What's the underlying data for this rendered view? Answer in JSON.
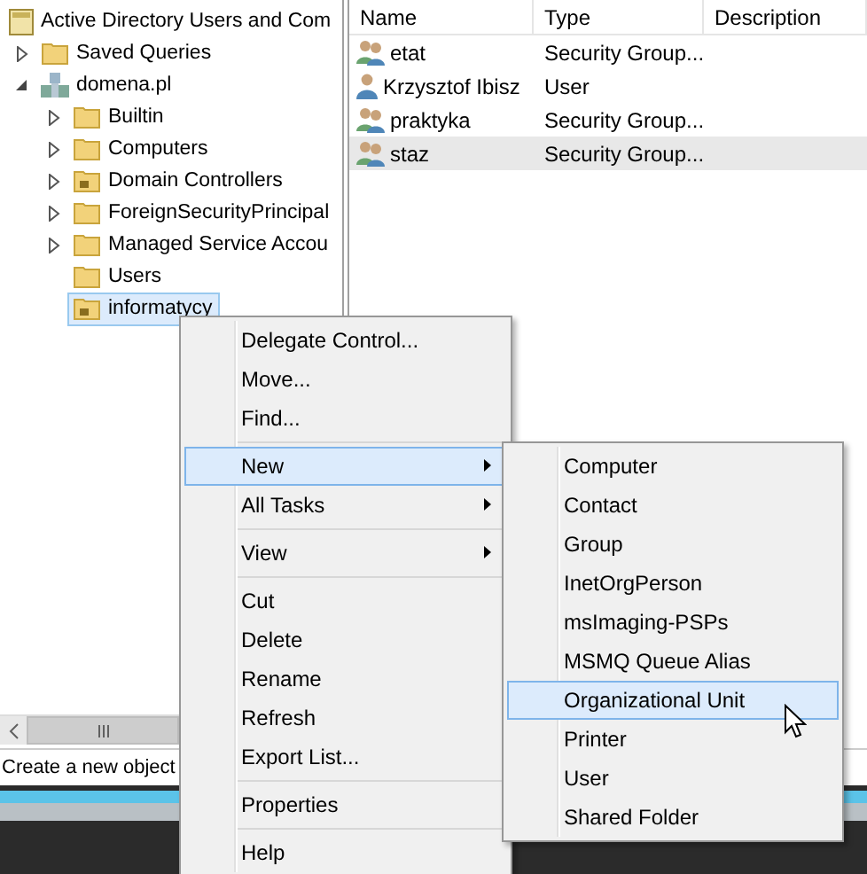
{
  "tree": {
    "title": "Active Directory Users and Com",
    "items": [
      {
        "label": "Saved Queries",
        "kind": "folder",
        "expandable": true,
        "expanded": false,
        "selected": false
      },
      {
        "label": "domena.pl",
        "kind": "domain",
        "expandable": true,
        "expanded": true,
        "selected": false,
        "children": [
          {
            "label": "Builtin",
            "kind": "folder",
            "expandable": true,
            "expanded": false,
            "selected": false
          },
          {
            "label": "Computers",
            "kind": "folder",
            "expandable": true,
            "expanded": false,
            "selected": false
          },
          {
            "label": "Domain Controllers",
            "kind": "ou",
            "expandable": true,
            "expanded": false,
            "selected": false
          },
          {
            "label": "ForeignSecurityPrincipal",
            "kind": "folder",
            "expandable": true,
            "expanded": false,
            "selected": false
          },
          {
            "label": "Managed Service Accou",
            "kind": "folder",
            "expandable": true,
            "expanded": false,
            "selected": false
          },
          {
            "label": "Users",
            "kind": "folder",
            "expandable": false,
            "selected": false
          },
          {
            "label": "informatycy",
            "kind": "ou",
            "expandable": false,
            "selected": true
          }
        ]
      }
    ]
  },
  "list": {
    "columns": [
      "Name",
      "Type",
      "Description"
    ],
    "rows": [
      {
        "name": "etat",
        "type": "Security Group...",
        "kind": "group",
        "selected": false
      },
      {
        "name": "Krzysztof Ibisz",
        "type": "User",
        "kind": "user",
        "selected": false
      },
      {
        "name": "praktyka",
        "type": "Security Group...",
        "kind": "group",
        "selected": false
      },
      {
        "name": "staz",
        "type": "Security Group...",
        "kind": "group",
        "selected": true
      }
    ]
  },
  "status_bar": "Create a new object",
  "context_menu": {
    "items": [
      {
        "kind": "item",
        "label": "Delegate Control...",
        "submenu": false,
        "selected": false
      },
      {
        "kind": "item",
        "label": "Move...",
        "submenu": false,
        "selected": false
      },
      {
        "kind": "item",
        "label": "Find...",
        "submenu": false,
        "selected": false
      },
      {
        "kind": "separator"
      },
      {
        "kind": "item",
        "label": "New",
        "submenu": true,
        "selected": true
      },
      {
        "kind": "item",
        "label": "All Tasks",
        "submenu": true,
        "selected": false
      },
      {
        "kind": "separator"
      },
      {
        "kind": "item",
        "label": "View",
        "submenu": true,
        "selected": false
      },
      {
        "kind": "separator"
      },
      {
        "kind": "item",
        "label": "Cut",
        "submenu": false,
        "selected": false
      },
      {
        "kind": "item",
        "label": "Delete",
        "submenu": false,
        "selected": false
      },
      {
        "kind": "item",
        "label": "Rename",
        "submenu": false,
        "selected": false
      },
      {
        "kind": "item",
        "label": "Refresh",
        "submenu": false,
        "selected": false
      },
      {
        "kind": "item",
        "label": "Export List...",
        "submenu": false,
        "selected": false
      },
      {
        "kind": "separator"
      },
      {
        "kind": "item",
        "label": "Properties",
        "submenu": false,
        "selected": false
      },
      {
        "kind": "separator"
      },
      {
        "kind": "item",
        "label": "Help",
        "submenu": false,
        "selected": false
      }
    ]
  },
  "submenu": {
    "items": [
      {
        "label": "Computer",
        "selected": false
      },
      {
        "label": "Contact",
        "selected": false
      },
      {
        "label": "Group",
        "selected": false
      },
      {
        "label": "InetOrgPerson",
        "selected": false
      },
      {
        "label": "msImaging-PSPs",
        "selected": false
      },
      {
        "label": "MSMQ Queue Alias",
        "selected": false
      },
      {
        "label": "Organizational Unit",
        "selected": true
      },
      {
        "label": "Printer",
        "selected": false
      },
      {
        "label": "User",
        "selected": false
      },
      {
        "label": "Shared Folder",
        "selected": false
      }
    ]
  }
}
